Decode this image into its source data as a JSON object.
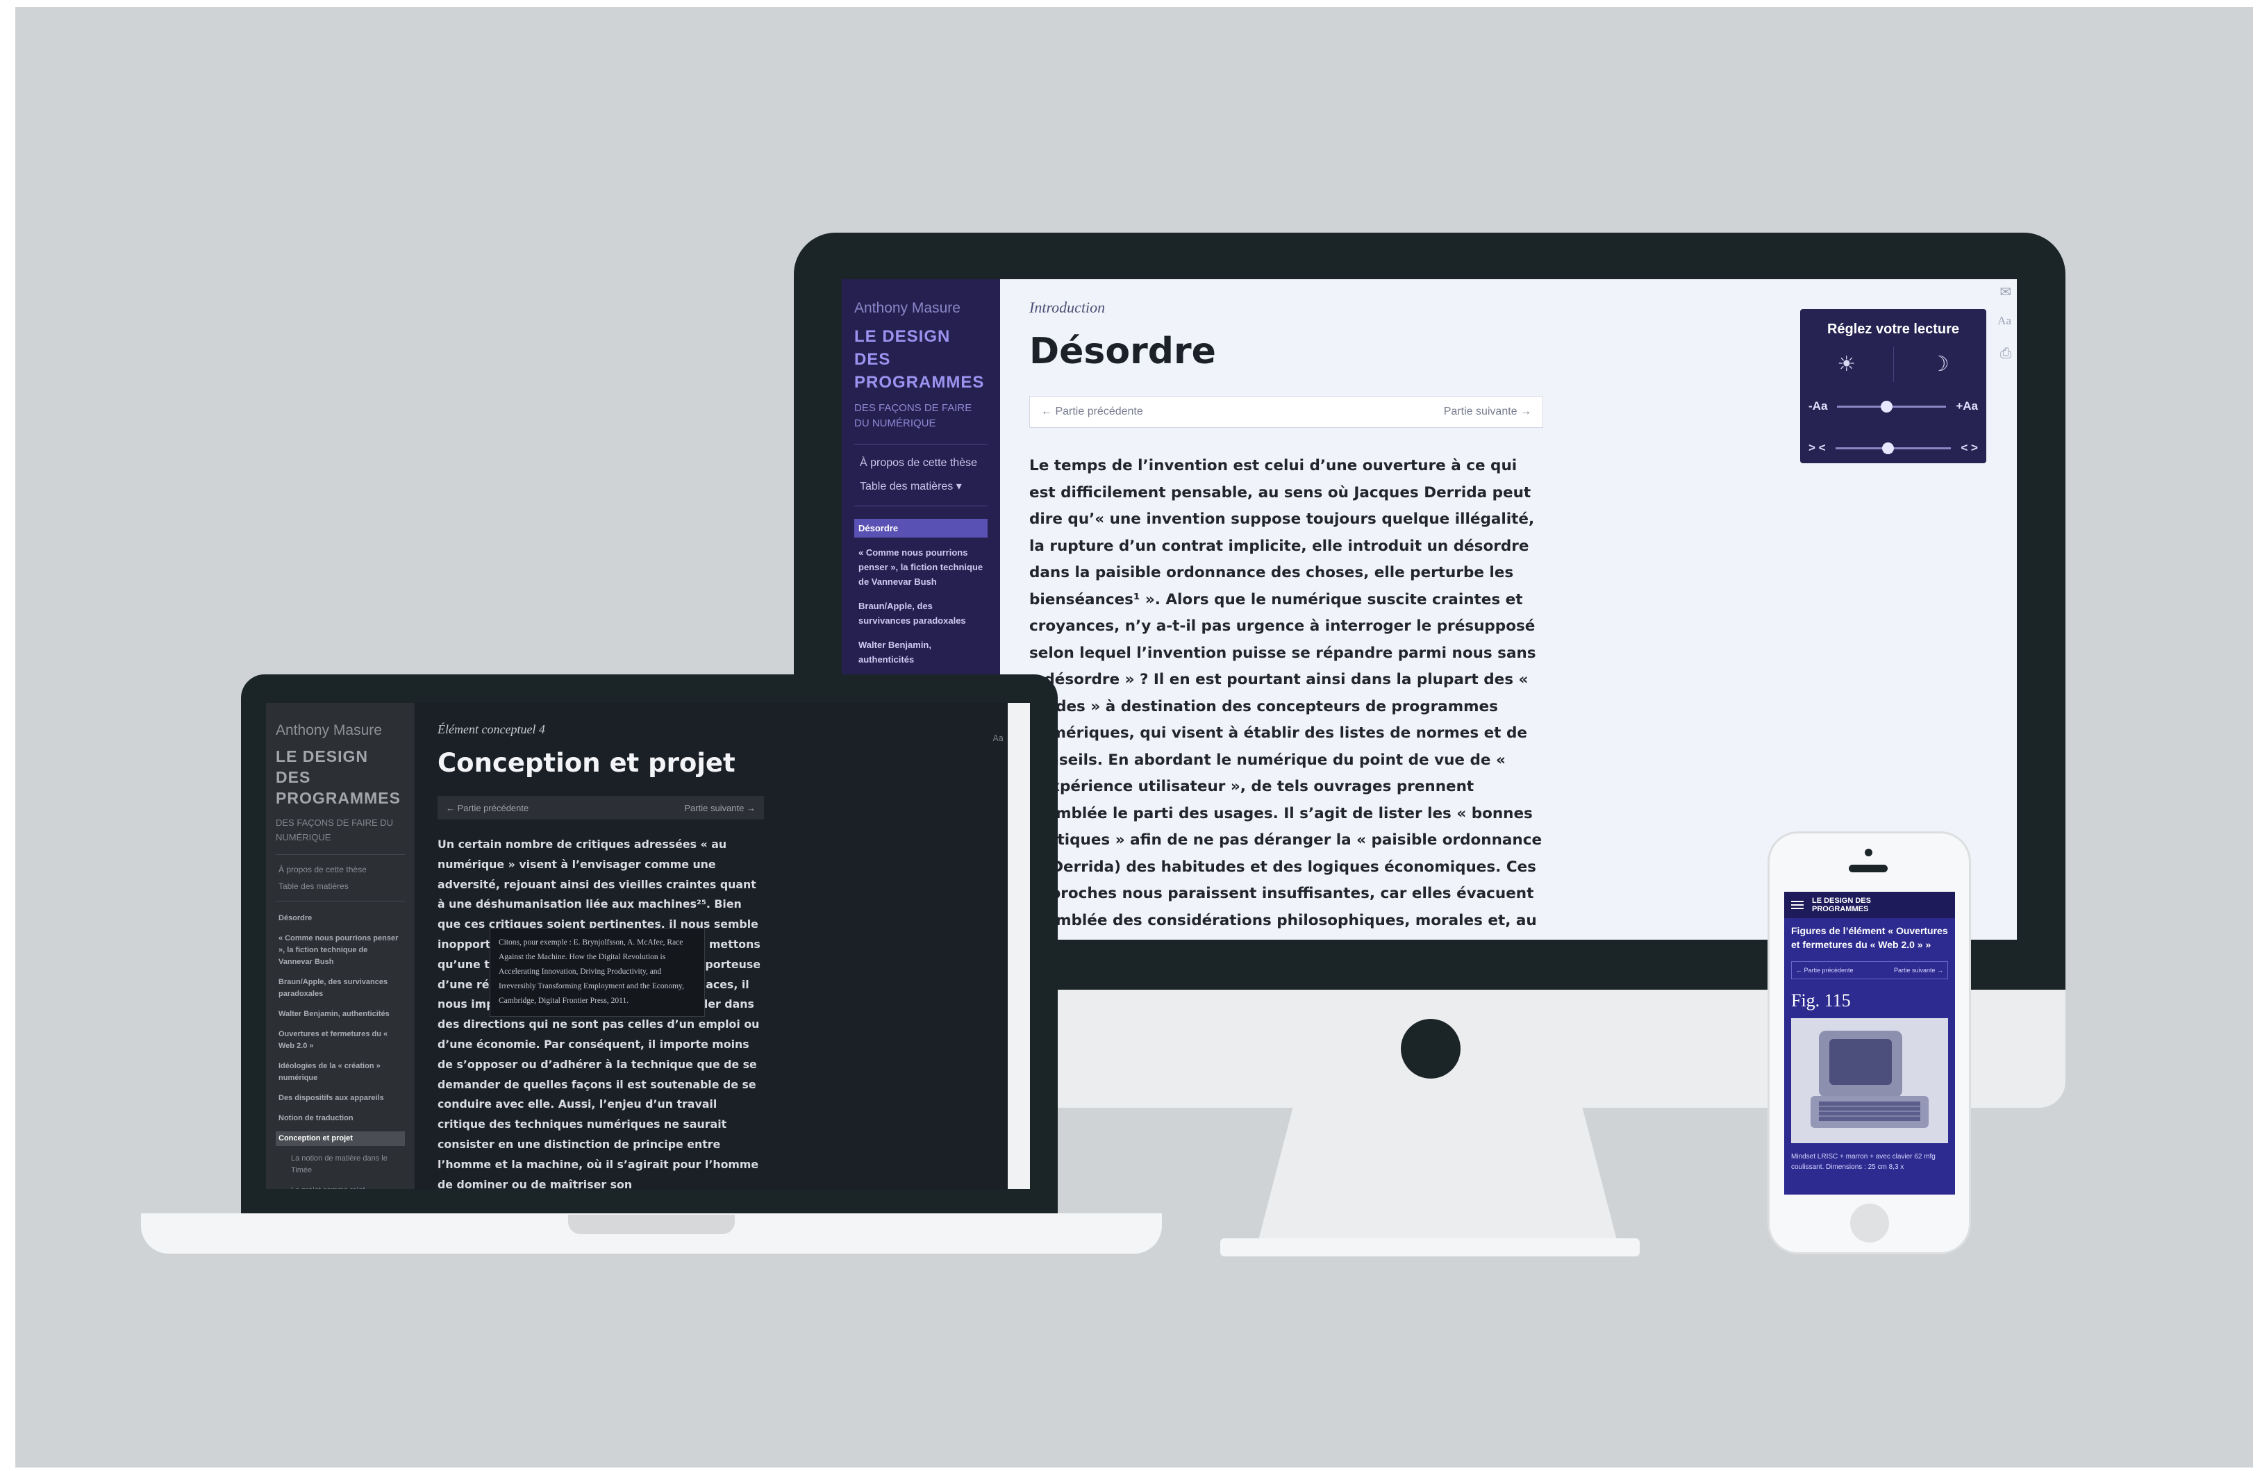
{
  "desktop": {
    "sidebar": {
      "author": "Anthony Masure",
      "book_title": "LE DESIGN DES PROGRAMMES",
      "subtitle": "DES FAÇONS DE FAIRE DU NUMÉRIQUE",
      "about_link": "À propos de cette thèse",
      "toc_link": "Table des matières ▾",
      "toc": [
        "Désordre",
        "« Comme nous pourrions penser », la fiction technique de Vannevar Bush",
        "Braun/Apple, des survivances paradoxales",
        "Walter Benjamin, authenticités"
      ]
    },
    "main": {
      "kicker": "Introduction",
      "title": "Désordre",
      "prev": "← Partie précédente",
      "next": "Partie suivante →",
      "body": "Le temps de l’invention est celui d’une ouverture à ce qui est difficilement pensable, au sens où Jacques Derrida peut dire qu’« une invention suppose toujours quelque illégalité, la rupture d’un contrat implicite, elle introduit un désordre dans la paisible ordonnance des choses, elle perturbe les bienséances¹ ». Alors que le numérique suscite craintes et croyances, n’y a-t-il pas urgence à interroger le présupposé selon lequel l’invention puisse se répandre parmi nous sans « désordre » ? Il en est pourtant ainsi dans la plupart des « guides » à destination des concepteurs de programmes numériques, qui visent à établir des listes de normes et de conseils. En abordant le numérique du point de vue de « l’expérience utilisateur », de tels ouvrages prennent d’emblée le parti des usages. Il s’agit de lister les « bonnes pratiques » afin de ne pas déranger la « paisible ordonnance » (Derrida) des habitudes et des logiques économiques. Ces approches nous paraissent insuffisantes, car elles évacuent d’emblée des considérations philosophiques, morales et, au fond, techniques. Ce qu’il s’y joue ne permet pas de dépasser ce qu’il y a déjà en jeu. La supposée"
    },
    "reading_panel": {
      "title": "Réglez votre lecture",
      "light_icon": "☀",
      "dark_icon": "☽",
      "size_minus": "-Aa",
      "size_plus": "+Aa",
      "width_minus": "> <",
      "width_plus": "< >",
      "size_level": 0.45,
      "width_level": 0.45
    },
    "tools": {
      "mail_icon": "✉",
      "aa_icon": "Aa",
      "print_icon": "⎙"
    }
  },
  "laptop": {
    "sidebar": {
      "author": "Anthony Masure",
      "book_title": "LE DESIGN DES PROGRAMMES",
      "subtitle": "DES FAÇONS DE FAIRE DU NUMÉRIQUE",
      "about_link": "À propos de cette thèse",
      "toc_link": "Table des matières",
      "toc": [
        "Désordre",
        "« Comme nous pourrions penser », la fiction technique de Vannevar Bush",
        "Braun/Apple, des survivances paradoxales",
        "Walter Benjamin, authenticités",
        "Ouvertures et fermetures du « Web 2.0 »",
        "Idéologies de la « création » numérique",
        "Des dispositifs aux appareils",
        "Notion de traduction",
        "Conception et projet",
        "La notion de matière dans le Timée",
        "Le projet comme rejet"
      ]
    },
    "main": {
      "kicker": "Élément conceptuel 4",
      "title": "Conception et projet",
      "prev": "← Partie précédente",
      "next": "Partie suivante →",
      "body": "Un certain nombre de critiques adressées « au numérique » visent à l’envisager comme une adversité, rejouant ainsi des vieilles craintes quant à une déshumanisation liée aux machines²⁵. Bien que ces critiques soient pertinentes, il nous semble inopportun de les reprendre sans que nous mettons qu’une telle approche puisse s’avérer être porteuse d’une réelle alternative. Plutôt que de menaces, il nous importe de toujours pouvoir la travailler dans des directions qui ne sont pas celles d’un emploi ou d’une économie. Par conséquent, il importe moins de s’opposer ou d’adhérer à la technique que de se demander de quelles façons il est soutenable de se conduire avec elle. Aussi, l’enjeu d’un travail critique des techniques numériques ne saurait consister en une distinction de principe entre l’homme et la machine, où il s’agirait pour l’homme de dominer ou de maîtriser son",
      "tooltip": "Citons, pour exemple : E. Brynjolfsson, A. McAfee, Race Against the Machine. How the Digital Revolution is Accelerating Innovation, Driving Productivity, and Irreversibly Transforming Employment and the Economy, Cambridge, Digital Frontier Press, 2011.",
      "aa_icon": "Aa"
    }
  },
  "phone": {
    "header_title": "LE DESIGN DES PROGRAMMES",
    "menu_icon": "hamburger-menu-icon",
    "heading": "Figures de l’élément « Ouvertures et fermetures du « Web 2.0 » »",
    "prev": "← Partie précédente",
    "next": "Partie suivante →",
    "figure_label": "Fig. 115",
    "caption": "Mindset LRISC + marron + avec clavier 62 mfg coulissant. Dimensions : 25 cm 8,3 x"
  }
}
